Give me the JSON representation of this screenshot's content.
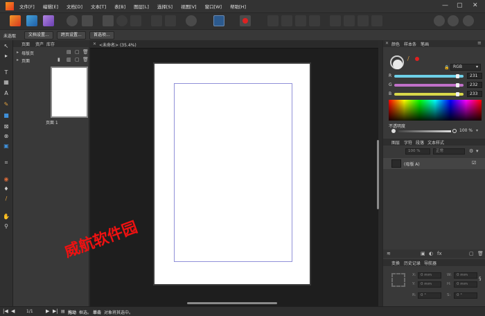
{
  "menu": [
    "文件[F]",
    "编辑[E]",
    "文档[D]",
    "文本[T]",
    "表[B]",
    "图层[L]",
    "选择[S]",
    "视图[V]",
    "窗口[W]",
    "帮助[H]"
  ],
  "window_controls": {
    "minimize": "—",
    "maximize": "▢",
    "close": "✕"
  },
  "context_bar": {
    "label": "未选取",
    "buttons": [
      "文档设置...",
      "跨页设置...",
      "首选项..."
    ]
  },
  "pages_panel": {
    "tabs": [
      "页面",
      "资产",
      "库存"
    ],
    "masters_label": "母版页",
    "pages_label": "页面",
    "thumb_label": "页面 1"
  },
  "document_tab": "<未命名> (35.4%)",
  "watermark": "威航软件园",
  "color_panel": {
    "tabs": [
      "颜色",
      "样本条",
      "笔画"
    ],
    "model": "RGB",
    "channels": [
      {
        "name": "R",
        "value": "231",
        "color": "#6ed0e8",
        "pos": 0.906
      },
      {
        "name": "G",
        "value": "232",
        "color": "#c070c8",
        "pos": 0.91
      },
      {
        "name": "B",
        "value": "233",
        "color": "#d8d84a",
        "pos": 0.914
      }
    ],
    "opacity_label": "不透明度",
    "opacity_value": "100 %"
  },
  "layers_panel": {
    "tabs": [
      "图层",
      "字符",
      "段落",
      "文本样式"
    ],
    "opacity": "100 %",
    "blend": "正常",
    "layer_name": "(母版 A)"
  },
  "transform_panel": {
    "tabs": [
      "变换",
      "历史记录",
      "导航器"
    ],
    "fields": [
      {
        "label": "X:",
        "value": "0 mm"
      },
      {
        "label": "W:",
        "value": "0 mm"
      },
      {
        "label": "Y:",
        "value": "0 mm"
      },
      {
        "label": "H:",
        "value": "0 mm"
      },
      {
        "label": "R:",
        "value": "0 °"
      },
      {
        "label": "S:",
        "value": "0 °"
      }
    ]
  },
  "status_bar": {
    "page": "1/1",
    "drag_label": "拖动",
    "drag_text": "框选。",
    "click_label": "单击",
    "click_text": "对象将其选中。"
  }
}
